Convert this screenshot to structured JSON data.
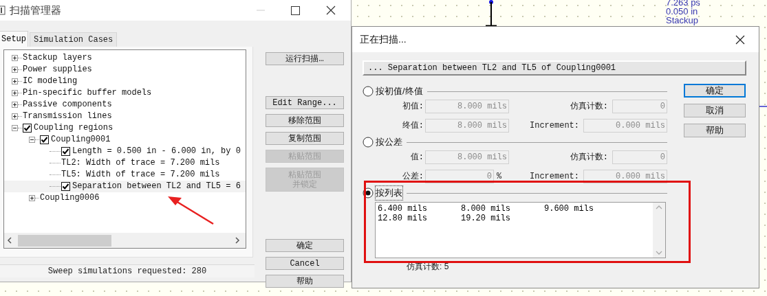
{
  "canvas": {
    "labels": [
      "7.263 ps",
      "0.050 in",
      "Stackup"
    ]
  },
  "scan_manager": {
    "title": "扫描管理器",
    "tabs": [
      {
        "label": "Setup",
        "selected": true
      },
      {
        "label": "Simulation Cases",
        "selected": false
      }
    ],
    "tree": [
      {
        "label": "Stackup layers",
        "kind": "plain",
        "expanded": false,
        "selected": false
      },
      {
        "label": "Power supplies",
        "kind": "plain",
        "expanded": false,
        "selected": false
      },
      {
        "label": "IC modeling",
        "kind": "plain",
        "expanded": false,
        "selected": false
      },
      {
        "label": "Pin-specific buffer models",
        "kind": "plain",
        "expanded": false,
        "selected": false
      },
      {
        "label": "Passive components",
        "kind": "plain",
        "expanded": false,
        "selected": false
      },
      {
        "label": "Transmission lines",
        "kind": "plain",
        "expanded": false,
        "selected": false
      },
      {
        "label": "Coupling regions",
        "kind": "checkbox",
        "checked": true,
        "expanded": true,
        "selected": false,
        "children": [
          {
            "label": "Coupling0001",
            "kind": "checkbox",
            "checked": true,
            "expanded": true,
            "selected": false,
            "children": [
              {
                "label": "Length = 0.500 in - 6.000 in, by 0",
                "kind": "checkbox",
                "checked": true,
                "selected": false
              },
              {
                "label": "TL2: Width of trace = 7.200 mils",
                "kind": "plain",
                "selected": false
              },
              {
                "label": "TL5: Width of trace = 7.200 mils",
                "kind": "plain",
                "selected": false
              },
              {
                "label": "Separation between TL2 and TL5 = 6",
                "kind": "checkbox",
                "checked": true,
                "selected": true
              }
            ]
          },
          {
            "label": "Coupling0006",
            "kind": "plain",
            "expanded": false,
            "selected": false
          }
        ]
      }
    ],
    "button_groups": [
      [
        {
          "label": "运行扫描…",
          "disabled": false
        }
      ],
      [
        {
          "label": "Edit Range...",
          "disabled": false
        },
        {
          "label": "移除范围",
          "disabled": false
        },
        {
          "label": "复制范围",
          "disabled": false
        },
        {
          "label": "粘贴范围",
          "disabled": true
        },
        {
          "label": "粘贴范围并锁定",
          "disabled": true
        }
      ],
      [
        {
          "label": "确定",
          "disabled": false
        },
        {
          "label": "Cancel",
          "disabled": false
        },
        {
          "label": "帮助",
          "disabled": false
        }
      ]
    ],
    "status": "Sweep simulations requested: 280"
  },
  "sweep_dialog": {
    "title": "正在扫描...",
    "parameter": "... Separation between TL2 and TL5 of Coupling0001",
    "options": [
      {
        "kind": "fields",
        "label": "按初值/终值",
        "selected": false,
        "fields": [
          {
            "label": "初值:",
            "value": "8.000 mils",
            "disabled": true
          },
          {
            "label": "仿真计数:",
            "value": "0",
            "disabled": true
          },
          {
            "label": "终值:",
            "value": "8.000 mils",
            "disabled": true
          },
          {
            "label": "Increment:",
            "value": "0.000 mils",
            "disabled": true
          }
        ]
      },
      {
        "kind": "fields",
        "label": "按公差",
        "selected": false,
        "fields": [
          {
            "label": "值:",
            "value": "8.000 mils",
            "disabled": true
          },
          {
            "label": "仿真计数:",
            "value": "0",
            "disabled": true
          },
          {
            "label": "公差:",
            "value": "0",
            "unit": "%",
            "disabled": true
          },
          {
            "label": "Increment:",
            "value": "0.000 mils",
            "disabled": true
          }
        ]
      },
      {
        "kind": "list",
        "label": "按列表",
        "selected": true,
        "values": [
          "6.400 mils",
          "8.000 mils",
          "9.600 mils",
          "12.80 mils",
          "19.20 mils"
        ],
        "count": "仿真计数: 5"
      }
    ],
    "buttons": [
      {
        "label": "确定",
        "default": true
      },
      {
        "label": "取消",
        "default": false
      },
      {
        "label": "帮助",
        "default": false
      }
    ]
  }
}
